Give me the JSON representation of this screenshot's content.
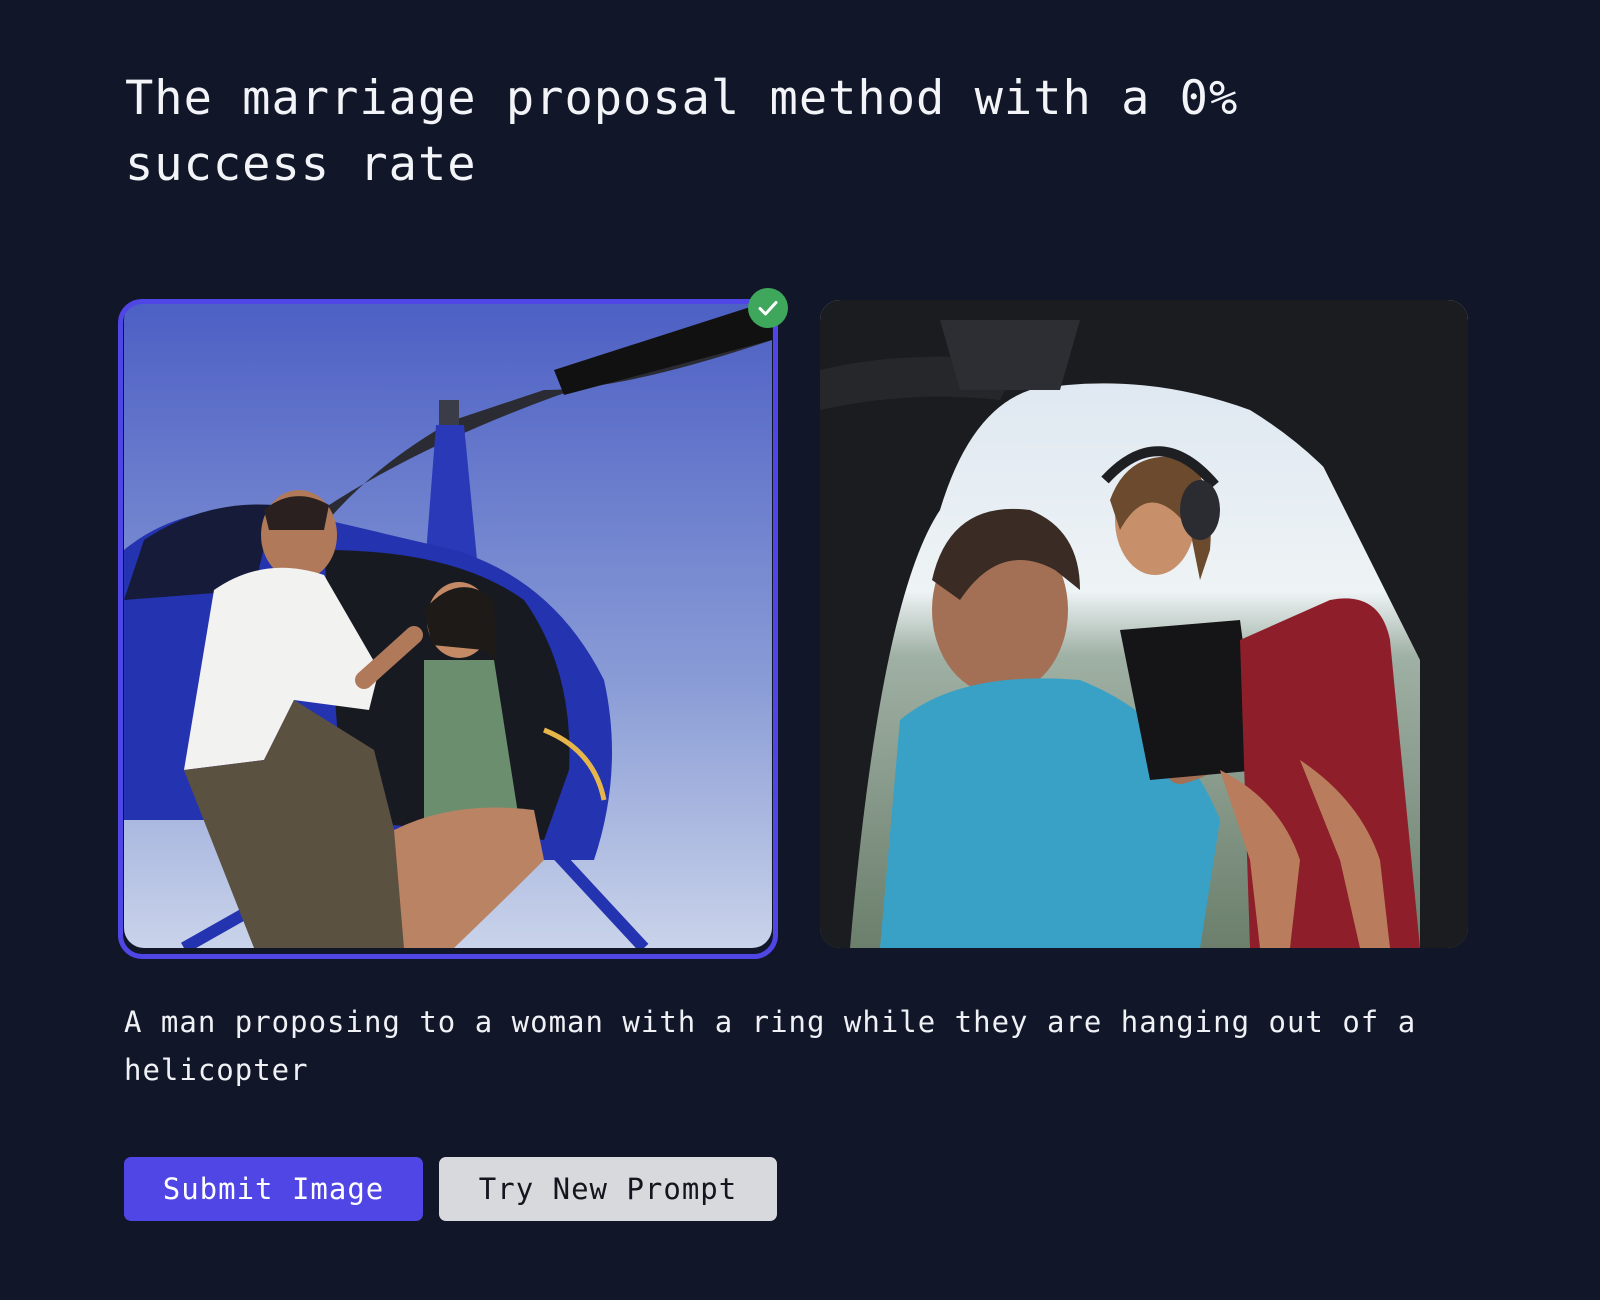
{
  "prompt": {
    "title": "The marriage proposal method with a 0% success rate"
  },
  "images": [
    {
      "selected": true,
      "check_icon": "check-circle-icon"
    },
    {
      "selected": false
    }
  ],
  "caption": "A man proposing to a woman with a ring while they are hanging out of a helicopter",
  "actions": {
    "submit_label": "Submit Image",
    "retry_label": "Try New Prompt"
  },
  "colors": {
    "background": "#111629",
    "accent": "#4f46e5",
    "check": "#3fa75c",
    "secondary_button": "#d8d9dd"
  }
}
